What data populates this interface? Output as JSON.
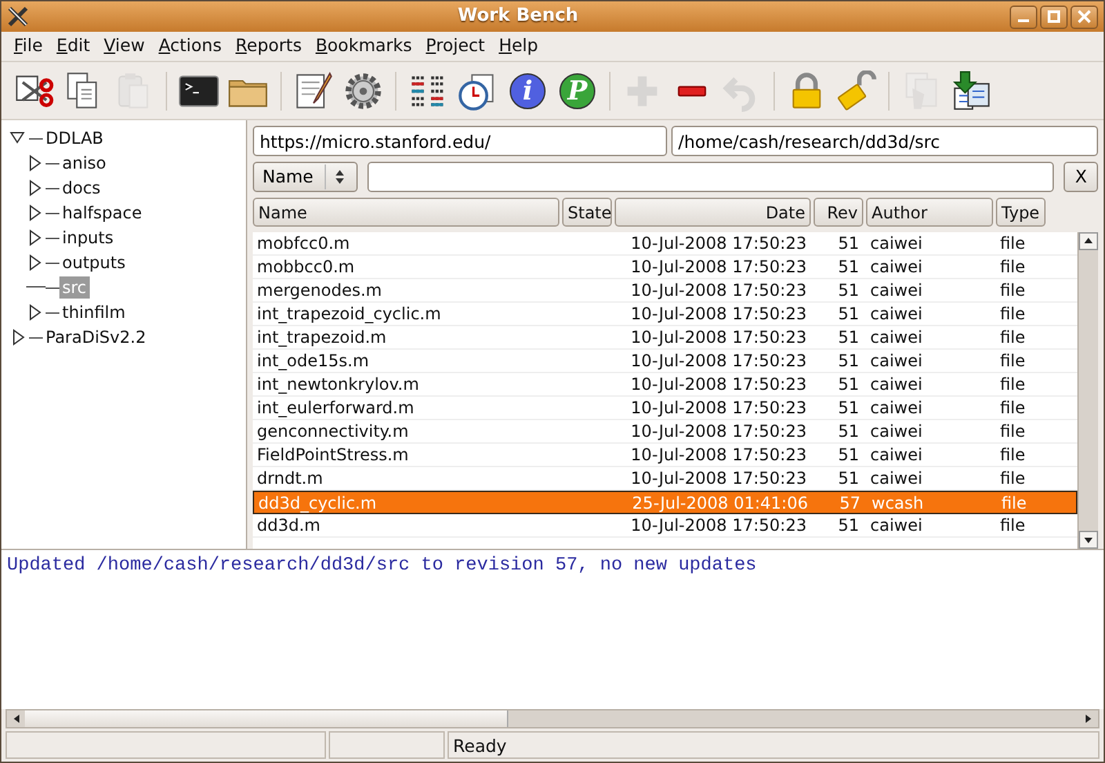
{
  "window": {
    "title": "Work Bench"
  },
  "menu": [
    "File",
    "Edit",
    "View",
    "Actions",
    "Reports",
    "Bookmarks",
    "Project",
    "Help"
  ],
  "toolbar": [
    {
      "kind": "cut",
      "disabled": false
    },
    {
      "kind": "copy",
      "disabled": false
    },
    {
      "kind": "paste",
      "disabled": true
    },
    {
      "kind": "sep"
    },
    {
      "kind": "terminal",
      "disabled": false
    },
    {
      "kind": "folder",
      "disabled": false
    },
    {
      "kind": "sep"
    },
    {
      "kind": "edit",
      "disabled": false
    },
    {
      "kind": "gear",
      "disabled": false
    },
    {
      "kind": "sep"
    },
    {
      "kind": "diff",
      "disabled": false
    },
    {
      "kind": "clock",
      "disabled": false
    },
    {
      "kind": "info",
      "label": "i",
      "disabled": false
    },
    {
      "kind": "letter",
      "label": "P",
      "disabled": false
    },
    {
      "kind": "sep"
    },
    {
      "kind": "add",
      "disabled": true
    },
    {
      "kind": "remove",
      "disabled": false
    },
    {
      "kind": "undo",
      "disabled": true
    },
    {
      "kind": "sep"
    },
    {
      "kind": "lock",
      "disabled": false
    },
    {
      "kind": "unlock",
      "disabled": false
    },
    {
      "kind": "sep"
    },
    {
      "kind": "copies",
      "disabled": true
    },
    {
      "kind": "download",
      "disabled": false
    }
  ],
  "tree": [
    {
      "label": "DDLAB",
      "has_children": true,
      "expanded": true,
      "selected": false,
      "children": [
        {
          "label": "aniso",
          "has_children": true,
          "expanded": false,
          "selected": false
        },
        {
          "label": "docs",
          "has_children": true,
          "expanded": false,
          "selected": false
        },
        {
          "label": "halfspace",
          "has_children": true,
          "expanded": false,
          "selected": false
        },
        {
          "label": "inputs",
          "has_children": true,
          "expanded": false,
          "selected": false
        },
        {
          "label": "outputs",
          "has_children": true,
          "expanded": false,
          "selected": false
        },
        {
          "label": "src",
          "has_children": false,
          "expanded": false,
          "selected": true
        },
        {
          "label": "thinfilm",
          "has_children": true,
          "expanded": false,
          "selected": false
        }
      ]
    },
    {
      "label": "ParaDiSv2.2",
      "has_children": true,
      "expanded": false,
      "selected": false
    }
  ],
  "url": "https://micro.stanford.edu/",
  "path": "/home/cash/research/dd3d/src",
  "filter": {
    "field": "Name",
    "clear": "X"
  },
  "table": {
    "columns": [
      {
        "label": "Name"
      },
      {
        "label": "State"
      },
      {
        "label": "Date"
      },
      {
        "label": "Rev"
      },
      {
        "label": "Author"
      },
      {
        "label": "Type"
      }
    ],
    "rows": [
      {
        "cells": [
          "mobfcc0.m",
          "",
          "10-Jul-2008 17:50:23",
          "51",
          "caiwei",
          "file"
        ],
        "selected": false
      },
      {
        "cells": [
          "mobbcc0.m",
          "",
          "10-Jul-2008 17:50:23",
          "51",
          "caiwei",
          "file"
        ],
        "selected": false
      },
      {
        "cells": [
          "mergenodes.m",
          "",
          "10-Jul-2008 17:50:23",
          "51",
          "caiwei",
          "file"
        ],
        "selected": false
      },
      {
        "cells": [
          "int_trapezoid_cyclic.m",
          "",
          "10-Jul-2008 17:50:23",
          "51",
          "caiwei",
          "file"
        ],
        "selected": false
      },
      {
        "cells": [
          "int_trapezoid.m",
          "",
          "10-Jul-2008 17:50:23",
          "51",
          "caiwei",
          "file"
        ],
        "selected": false
      },
      {
        "cells": [
          "int_ode15s.m",
          "",
          "10-Jul-2008 17:50:23",
          "51",
          "caiwei",
          "file"
        ],
        "selected": false
      },
      {
        "cells": [
          "int_newtonkrylov.m",
          "",
          "10-Jul-2008 17:50:23",
          "51",
          "caiwei",
          "file"
        ],
        "selected": false
      },
      {
        "cells": [
          "int_eulerforward.m",
          "",
          "10-Jul-2008 17:50:23",
          "51",
          "caiwei",
          "file"
        ],
        "selected": false
      },
      {
        "cells": [
          "genconnectivity.m",
          "",
          "10-Jul-2008 17:50:23",
          "51",
          "caiwei",
          "file"
        ],
        "selected": false
      },
      {
        "cells": [
          "FieldPointStress.m",
          "",
          "10-Jul-2008 17:50:23",
          "51",
          "caiwei",
          "file"
        ],
        "selected": false
      },
      {
        "cells": [
          "drndt.m",
          "",
          "10-Jul-2008 17:50:23",
          "51",
          "caiwei",
          "file"
        ],
        "selected": false
      },
      {
        "cells": [
          "dd3d_cyclic.m",
          "",
          "25-Jul-2008 01:41:06",
          "57",
          "wcash",
          "file"
        ],
        "selected": true
      },
      {
        "cells": [
          "dd3d.m",
          "",
          "10-Jul-2008 17:50:23",
          "51",
          "caiwei",
          "file"
        ],
        "selected": false
      }
    ]
  },
  "log": "Updated /home/cash/research/dd3d/src to revision 57, no new updates",
  "status_bar": {
    "message": "Ready"
  }
}
